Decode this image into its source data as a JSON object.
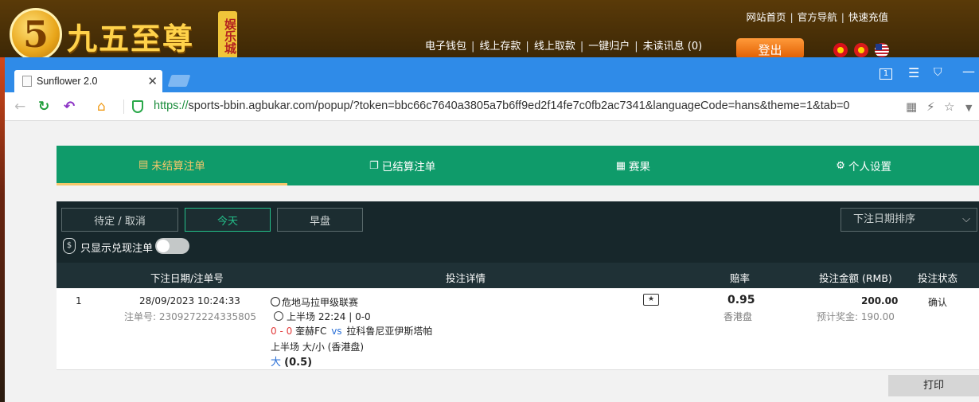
{
  "site": {
    "logo_numeral": "5",
    "logo_text": "九五至尊",
    "logo_badge": "娱乐城",
    "top_links": [
      "网站首页",
      "官方导航",
      "快速充值"
    ],
    "main_links": [
      "电子钱包",
      "线上存款",
      "线上取款",
      "一键归户",
      "未读讯息 (0)"
    ],
    "login_label": "登出"
  },
  "browser": {
    "tab_title": "Sunflower 2.0",
    "tab_close": "✕",
    "window_count": "1",
    "url_protocol": "https://",
    "url_rest": "sports-bbin.agbukar.com/popup/?token=bbc66c7640a3805a7b6ff9ed2f14fe7c0fb2ac7341&languageCode=hans&theme=1&tab=0"
  },
  "menu": {
    "unsettled": "未结算注单",
    "settled": "已结算注单",
    "results": "赛果",
    "settings": "个人设置"
  },
  "filters": {
    "pending": "待定 / 取消",
    "today": "今天",
    "early": "早盘",
    "sort": "下注日期排序",
    "cashout_only": "只显示兑现注单"
  },
  "table": {
    "headers": {
      "date": "下注日期/注单号",
      "detail": "投注详情",
      "odds": "赔率",
      "amount": "投注金额 (RMB)",
      "status": "投注状态"
    },
    "rows": [
      {
        "index": "1",
        "date": "28/09/2023 10:24:33",
        "bet_no": "注单号: 2309272224335805",
        "league": "危地马拉甲级联赛",
        "time": "上半场 22:24 | 0-0",
        "score": "0 - 0",
        "home": "奎赫FC",
        "vs": "vs",
        "away": "拉科鲁尼亚伊斯塔帕",
        "market": "上半场 大/小 (香港盘)",
        "pick": "大",
        "line": "(0.5)",
        "odds": "0.95",
        "odds_type": "香港盘",
        "stake": "200.00",
        "payout": "预计奖金: 190.00",
        "status": "确认"
      }
    ]
  },
  "print_label": "打印"
}
